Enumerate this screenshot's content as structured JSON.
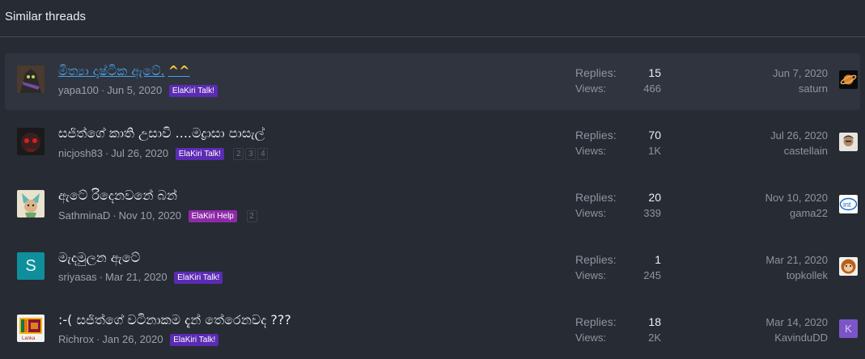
{
  "header": {
    "title": "Similar threads"
  },
  "labels": {
    "replies": "Replies:",
    "views": "Views:"
  },
  "colors": {
    "elakiri_talk": "#5b2bb4",
    "elakiri_help": "#8e2aa8"
  },
  "threads": [
    {
      "title": "මිත්‍යා දෘෂ්ටික ඇටේ.",
      "emoji": "^^",
      "author": "yapa100",
      "date": "Jun 5, 2020",
      "prefix": "ElaKiri Talk!",
      "pages": [],
      "replies": "15",
      "views": "466",
      "last_date": "Jun 7, 2020",
      "last_user": "saturn",
      "avatar_icon": "dark-figure-avatar",
      "last_avatar_icon": "saturn-planet-avatar"
    },
    {
      "title": "සජිත්ගේ කාති උසාවි ....මද්‍රාසා පාසැල්",
      "author": "nicjosh83",
      "date": "Jul 26, 2020",
      "prefix": "ElaKiri Talk!",
      "pages": [
        "2",
        "3",
        "4"
      ],
      "replies": "70",
      "views": "1K",
      "last_date": "Jul 26, 2020",
      "last_user": "castellain",
      "avatar_icon": "red-eyes-avatar",
      "last_avatar_icon": "face-photo-avatar"
    },
    {
      "title": "ඇටේ රිදෙනවනේ බන්",
      "author": "SathminaD",
      "date": "Nov 10, 2020",
      "prefix": "ElaKiri Help",
      "pages": [
        "2"
      ],
      "replies": "20",
      "views": "339",
      "last_date": "Nov 10, 2020",
      "last_user": "gama22",
      "avatar_icon": "cartoon-character-avatar",
      "last_avatar_icon": "intel-logo-avatar"
    },
    {
      "title": "මැදමුලන ඇටේ",
      "author": "sriyasas",
      "date": "Mar 21, 2020",
      "prefix": "ElaKiri Talk!",
      "pages": [],
      "replies": "1",
      "views": "245",
      "last_date": "Mar 21, 2020",
      "last_user": "topkollek",
      "avatar_letter": "S",
      "avatar_icon": "letter-s-avatar",
      "last_avatar_icon": "monkey-face-avatar"
    },
    {
      "title": ":-( සජිත්ගේ වටිනාකම දැන් තේරෙනවද ???",
      "author": "Richrox",
      "date": "Jan 26, 2020",
      "prefix": "ElaKiri Talk!",
      "pages": [],
      "replies": "18",
      "views": "2K",
      "last_date": "Mar 14, 2020",
      "last_user": "KavinduDD",
      "last_avatar_letter": "K",
      "avatar_icon": "sri-lanka-flag-avatar",
      "last_avatar_icon": "letter-k-avatar"
    }
  ]
}
